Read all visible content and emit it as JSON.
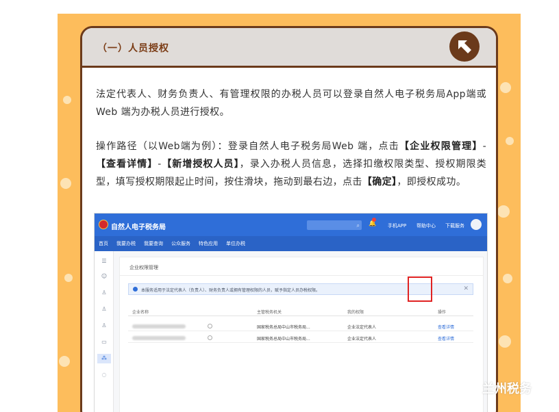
{
  "card": {
    "title": "（一）人员授权",
    "para1": "法定代表人、财务负责人、有管理权限的办税人员可以登录自然人电子税务局App端或Web 端为办税人员进行授权。",
    "para2_parts": [
      "操作路径（以Web端为例）：登录自然人电子税务局Web 端，点击",
      "【企业权限管理】",
      "-",
      "【查看详情】",
      "-",
      "【新增授权人员】",
      "，录入办税人员信息，选择扣缴权限类型、授权期限类型，填写授权期限起止时间，按住滑块，拖动到最右边，点击",
      "【确定】",
      "，即授权成功。"
    ]
  },
  "screenshot": {
    "site_name": "自然人电子税务局",
    "top_links": [
      "手机APP",
      "帮助中心",
      "下载服务"
    ],
    "nav_items": [
      "首页",
      "我要办税",
      "我要查询",
      "公众服务",
      "特色应用",
      "单位办税"
    ],
    "breadcrumb": "企业权限管理",
    "notice": "本服务适用于法定代表人（负责人）、财务负责人或拥有管理权限的人员，赋予指定人员办税权限。",
    "table": {
      "headers": [
        "企业名称",
        "主管税务机关",
        "我的权限",
        "操作"
      ],
      "rows": [
        {
          "tax_office": "国家税务总局中山市税务局...",
          "permission": "企业法定代表人",
          "action": "查看详情"
        },
        {
          "tax_office": "国家税务总局中山市税务局...",
          "permission": "企业法定代表人",
          "action": "查看详情"
        }
      ]
    }
  },
  "watermark": "兰州税务",
  "colors": {
    "orange_bg": "#fdbd5c",
    "brown_border": "#6b3a1b",
    "title_text": "#7a3b14",
    "blue_header": "#2f6ed8",
    "highlight_red": "#e02222"
  }
}
